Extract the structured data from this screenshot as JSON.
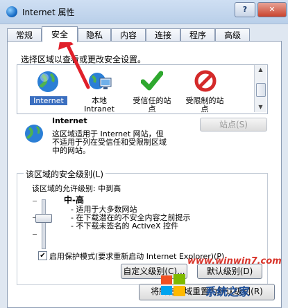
{
  "window": {
    "title": "Internet 属性",
    "help": "?",
    "close": "✕"
  },
  "tabs": [
    "常规",
    "安全",
    "隐私",
    "内容",
    "连接",
    "程序",
    "高级"
  ],
  "security": {
    "zone_prompt": "选择区域以查看或更改安全设置。",
    "zones": [
      {
        "label_line1": "Internet",
        "label_line2": "",
        "icon": "globe-icon",
        "selected": true
      },
      {
        "label_line1": "本地",
        "label_line2": "Intranet",
        "icon": "intranet-icon",
        "selected": false
      },
      {
        "label_line1": "受信任的站",
        "label_line2": "点",
        "icon": "green-check-icon",
        "selected": false
      },
      {
        "label_line1": "受限制的站",
        "label_line2": "点",
        "icon": "restricted-icon",
        "selected": false
      }
    ],
    "zone_title": "Internet",
    "zone_desc": [
      "这区域适用于 Internet 网站，但",
      "不适用于列在受信任和受限制区域",
      "中的网站。"
    ],
    "sites_button": "站点(S)",
    "level_group_title": "该区域的安全级别(L)",
    "allowed_levels": "该区域的允许级别: 中到高",
    "level_name": "中-高",
    "level_bullets": [
      "- 适用于大多数网站",
      "- 在下载潜在的不安全内容之前提示",
      "- 不下载未签名的 ActiveX 控件"
    ],
    "protected_mode": "启用保护模式(要求重新启动 Internet Explorer)(P)",
    "protected_mode_checked": "✔",
    "custom_level_button": "自定义级别(C)...",
    "default_level_button": "默认级别(D)",
    "reset_all_button": "将所有区域重置为默认级别(R)"
  },
  "watermark": {
    "site": "www.winwin7.com",
    "brand": "系统之家"
  },
  "colors": {
    "arrow": "#e0202a",
    "selection": "#3b6fc0"
  }
}
